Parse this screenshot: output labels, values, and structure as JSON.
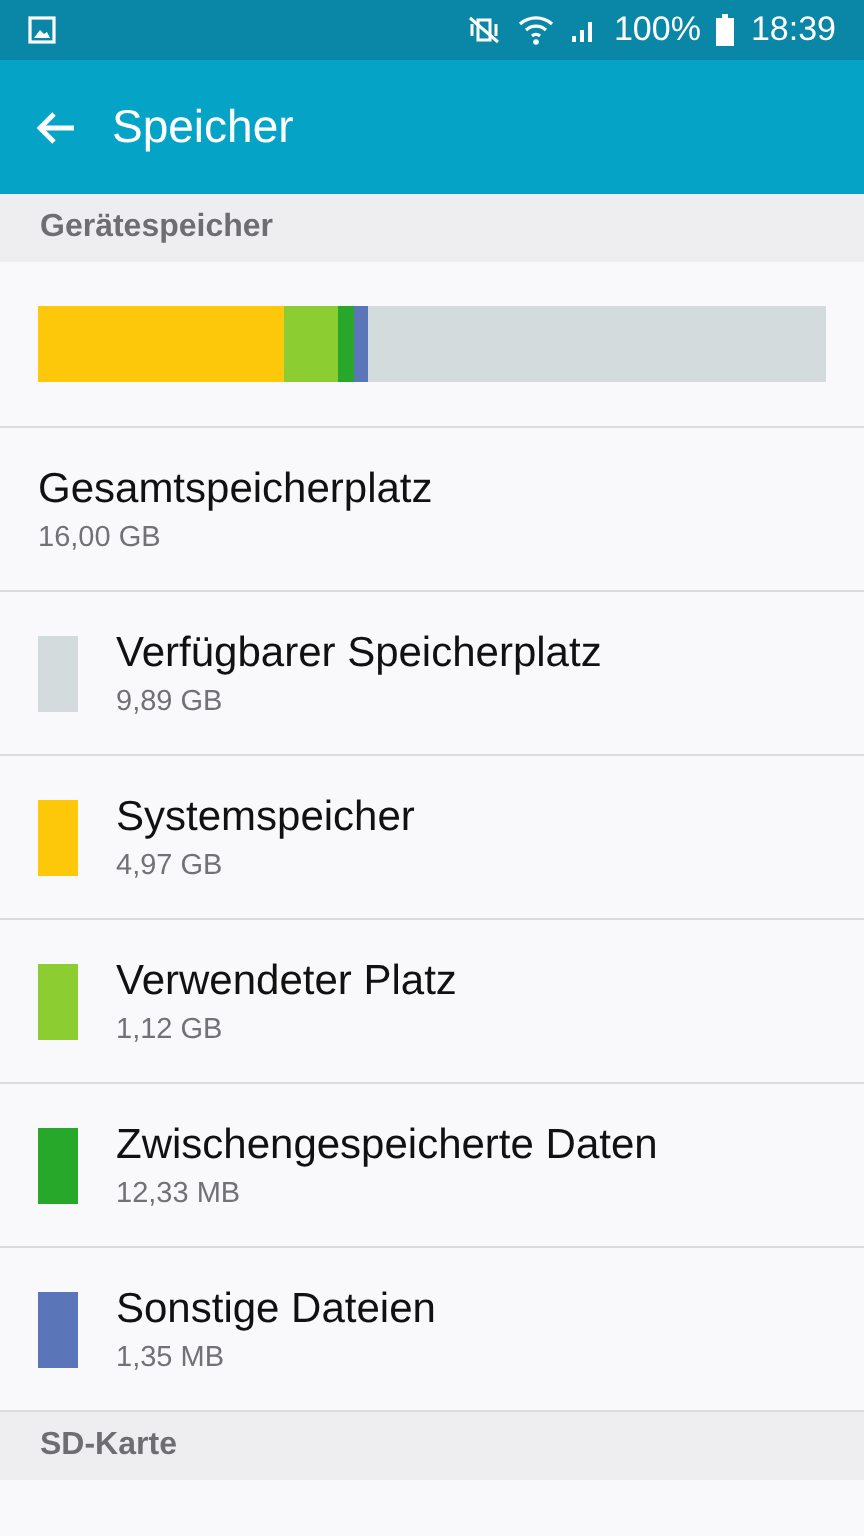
{
  "status_bar": {
    "battery": "100%",
    "time": "18:39"
  },
  "app_bar": {
    "title": "Speicher"
  },
  "sections": [
    {
      "title": "Gerätespeicher"
    }
  ],
  "total": {
    "label": "Gesamtspeicherplatz",
    "value": "16,00 GB"
  },
  "categories": [
    {
      "label": "Verfügbarer Speicherplatz",
      "value": "9,89 GB",
      "color": "#d3dbdd"
    },
    {
      "label": "Systemspeicher",
      "value": "4,97 GB",
      "color": "#fdc80a"
    },
    {
      "label": "Verwendeter Platz",
      "value": "1,12 GB",
      "color": "#8ccd32"
    },
    {
      "label": "Zwischengespeicherte Daten",
      "value": "12,33 MB",
      "color": "#27a82b"
    },
    {
      "label": "Sonstige Dateien",
      "value": "1,35 MB",
      "color": "#5a76b9"
    }
  ],
  "sd_section": {
    "title": "SD-Karte"
  }
}
